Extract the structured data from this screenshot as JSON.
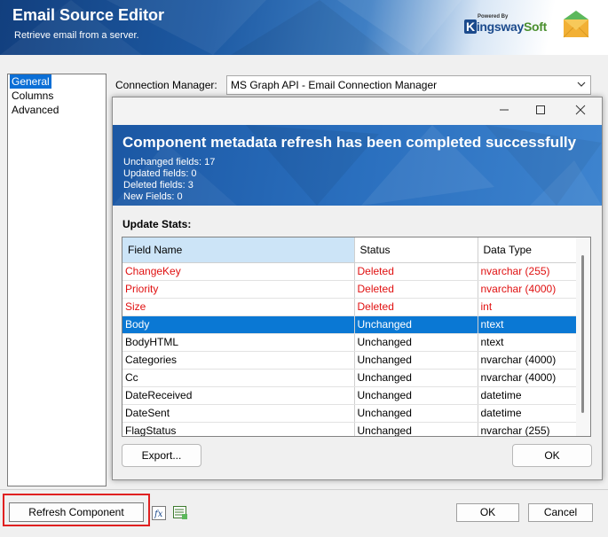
{
  "window": {
    "title": "Email Source Editor",
    "subtitle": "Retrieve email from a server.",
    "logo_powered": "Powered By",
    "logo_word_k": "K",
    "logo_word_ingsway": "ingsway",
    "logo_word_soft": "Soft",
    "brand_color": "#1d5aa3"
  },
  "nav": {
    "items": [
      {
        "label": "General",
        "selected": true
      },
      {
        "label": "Columns",
        "selected": false
      },
      {
        "label": "Advanced",
        "selected": false
      }
    ]
  },
  "connection": {
    "label": "Connection Manager:",
    "value": "MS Graph API - Email Connection Manager"
  },
  "dialog": {
    "heading": "Component metadata refresh has been completed successfully",
    "stats": [
      "Unchanged fields: 17",
      "Updated fields: 0",
      "Deleted fields: 3",
      "New Fields: 0"
    ],
    "update_stats_label": "Update Stats:",
    "columns": [
      "Field Name",
      "Status",
      "Data Type"
    ],
    "rows": [
      {
        "field": "ChangeKey",
        "status": "Deleted",
        "type": "nvarchar (255)"
      },
      {
        "field": "Priority",
        "status": "Deleted",
        "type": "nvarchar (4000)"
      },
      {
        "field": "Size",
        "status": "Deleted",
        "type": "int"
      },
      {
        "field": "Body",
        "status": "Unchanged",
        "type": "ntext"
      },
      {
        "field": "BodyHTML",
        "status": "Unchanged",
        "type": "ntext"
      },
      {
        "field": "Categories",
        "status": "Unchanged",
        "type": "nvarchar (4000)"
      },
      {
        "field": "Cc",
        "status": "Unchanged",
        "type": "nvarchar (4000)"
      },
      {
        "field": "DateReceived",
        "status": "Unchanged",
        "type": "datetime"
      },
      {
        "field": "DateSent",
        "status": "Unchanged",
        "type": "datetime"
      },
      {
        "field": "FlagStatus",
        "status": "Unchanged",
        "type": "nvarchar (255)"
      }
    ],
    "selected_row": "Body",
    "export_label": "Export...",
    "ok_label": "OK",
    "deleted_color": "#e01010",
    "selected_color": "#0a78d4"
  },
  "footer": {
    "refresh_label": "Refresh Component",
    "ok_label": "OK",
    "cancel_label": "Cancel",
    "highlight_color": "#e02020"
  }
}
